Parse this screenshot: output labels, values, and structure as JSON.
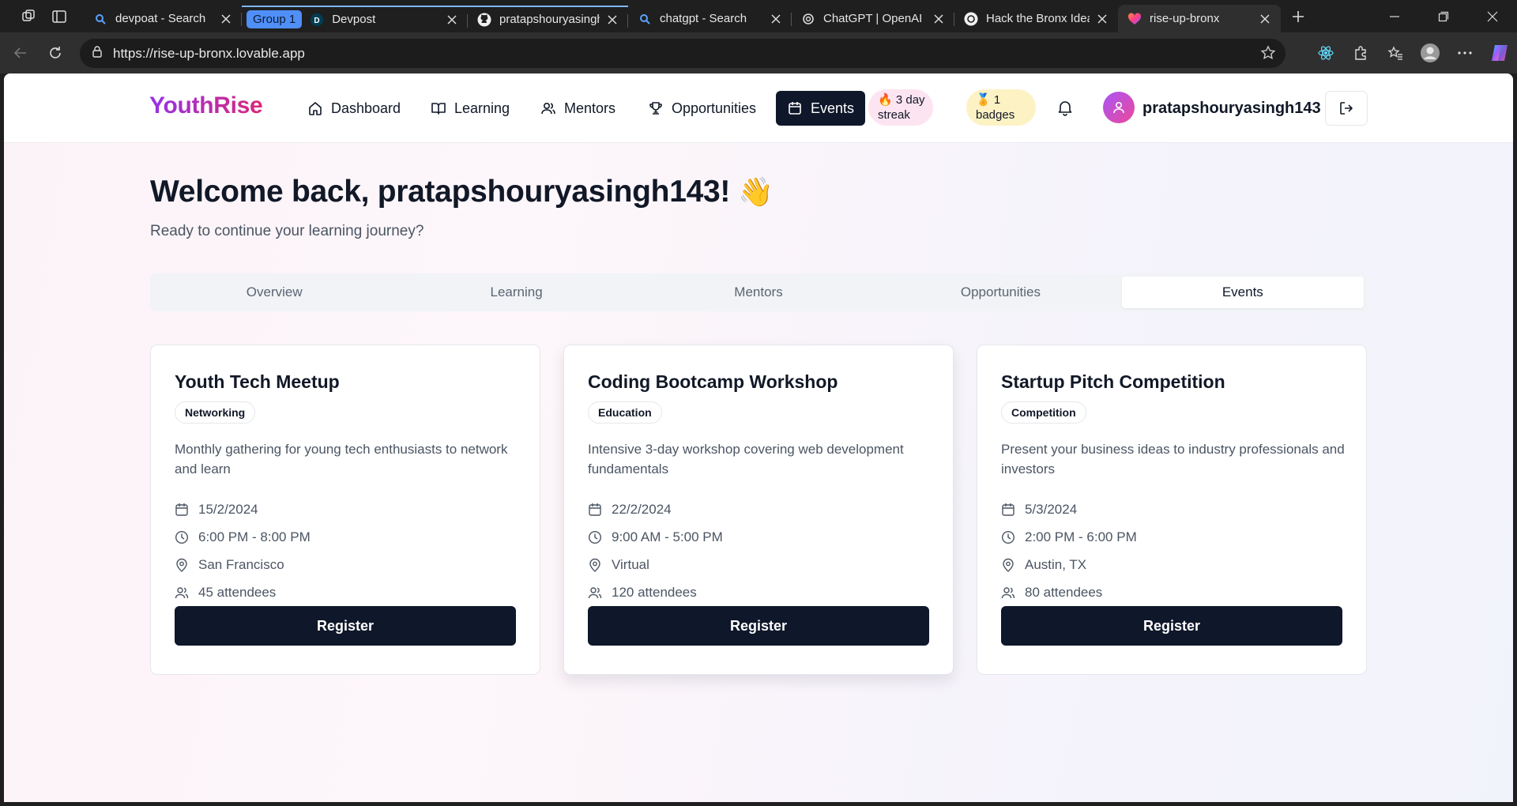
{
  "browser": {
    "tabs": [
      {
        "title": "devpoat - Search",
        "icon": "search-icon"
      },
      {
        "group": "Group 1",
        "title": "Devpost",
        "icon": "devpost-logo-icon"
      },
      {
        "title": "pratapshouryasingh",
        "icon": "github-icon"
      },
      {
        "title": "chatgpt - Search",
        "icon": "search-icon"
      },
      {
        "title": "ChatGPT | OpenAI",
        "icon": "openai-icon"
      },
      {
        "title": "Hack the Bronx Idea",
        "icon": "openai-icon"
      },
      {
        "title": "rise-up-bronx",
        "icon": "lovable-heart-icon"
      }
    ],
    "url": "https://rise-up-bronx.lovable.app"
  },
  "app": {
    "logo": "YouthRise",
    "nav": {
      "dashboard": "Dashboard",
      "learning": "Learning",
      "mentors": "Mentors",
      "opportunities": "Opportunities",
      "events": "Events"
    },
    "streak": {
      "line1": "🔥 3 day",
      "line2": "streak"
    },
    "badges": {
      "line1": "🏅 1",
      "line2": "badges"
    },
    "username": "pratapshouryasingh143"
  },
  "main": {
    "welcome": "Welcome back, pratapshouryasingh143!",
    "wave": "👋",
    "subtitle": "Ready to continue your learning journey?",
    "tabs": [
      {
        "label": "Overview"
      },
      {
        "label": "Learning"
      },
      {
        "label": "Mentors"
      },
      {
        "label": "Opportunities"
      },
      {
        "label": "Events",
        "active": true
      }
    ],
    "events": [
      {
        "title": "Youth Tech Meetup",
        "tag": "Networking",
        "description": "Monthly gathering for young tech enthusiasts to network and learn",
        "date": "15/2/2024",
        "time": "6:00 PM - 8:00 PM",
        "location": "San Francisco",
        "attendees": "45 attendees",
        "button": "Register"
      },
      {
        "title": "Coding Bootcamp Workshop",
        "tag": "Education",
        "description": "Intensive 3-day workshop covering web development fundamentals",
        "date": "22/2/2024",
        "time": "9:00 AM - 5:00 PM",
        "location": "Virtual",
        "attendees": "120 attendees",
        "button": "Register"
      },
      {
        "title": "Startup Pitch Competition",
        "tag": "Competition",
        "description": "Present your business ideas to industry professionals and investors",
        "date": "5/3/2024",
        "time": "2:00 PM - 6:00 PM",
        "location": "Austin, TX",
        "attendees": "80 attendees",
        "button": "Register"
      }
    ]
  }
}
